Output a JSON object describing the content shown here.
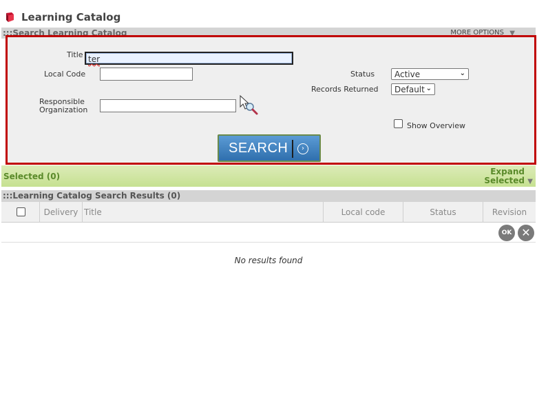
{
  "header": {
    "title": "Learning Catalog",
    "icon": "book-icon",
    "icon_color": "#c8102e"
  },
  "search_panel": {
    "title": ":::Search Learning Catalog",
    "more_options": "MORE OPTIONS",
    "highlight_color": "#c00000"
  },
  "form": {
    "title_label": "Title",
    "title_value": "ter",
    "local_code_label": "Local Code",
    "local_code_value": "",
    "responsible_org_label_line1": "Responsible",
    "responsible_org_label_line2": "Organization",
    "responsible_org_value": "",
    "status_label": "Status",
    "status_value": "Active",
    "records_label": "Records Returned",
    "records_value": "Default",
    "show_overview_label": "Show Overview",
    "show_overview_checked": false,
    "search_button": "SEARCH"
  },
  "selected": {
    "label": "Selected (0)",
    "expand_line1": "Expand",
    "expand_line2": "Selected"
  },
  "results": {
    "title": ":::Learning Catalog Search Results (0)",
    "columns": [
      "Delivery",
      "Title",
      "Local code",
      "Status",
      "Revision"
    ],
    "ok_label": "OK",
    "empty_message": "No results found"
  },
  "colors": {
    "accent_blue": "#2f6fad",
    "selected_green": "#5a8a2a"
  }
}
